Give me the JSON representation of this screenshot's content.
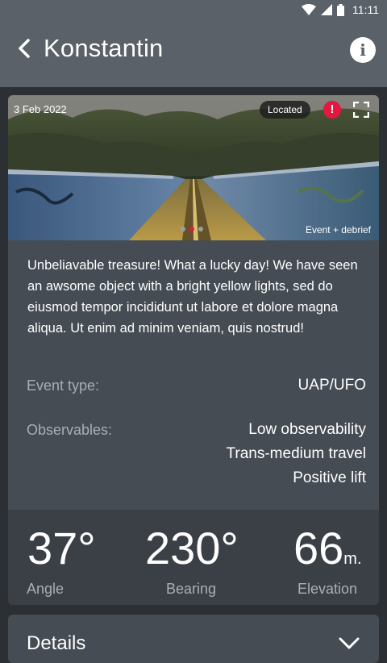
{
  "status_bar": {
    "time": "11:11",
    "icons": [
      "wifi-icon",
      "signal-icon",
      "battery-icon"
    ]
  },
  "app_bar": {
    "title": "Konstantin",
    "back_icon": "chevron-left-icon",
    "info_icon": "info-icon"
  },
  "card": {
    "date": "3 Feb 2022",
    "badge": "Located",
    "alert_glyph": "!",
    "caption": "Event + debrief",
    "carousel": {
      "count": 3,
      "active_index": 1
    },
    "description": "Unbeliavable treasure! What a lucky day! We have seen an awsome object with a bright yellow lights, sed do eiusmod tempor incididunt ut labore et dolore magna aliqua. Ut enim ad minim veniam, quis nostrud!",
    "event_type": {
      "label": "Event type:",
      "value": "UAP/UFO"
    },
    "observables": {
      "label": "Observables:",
      "values": [
        "Low observability",
        "Trans-medium travel",
        "Positive lift"
      ]
    },
    "stats": [
      {
        "value": "37°",
        "unit": "",
        "label": "Angle"
      },
      {
        "value": "230°",
        "unit": "",
        "label": "Bearing"
      },
      {
        "value": "66",
        "unit": "m.",
        "label": "Elevation"
      }
    ]
  },
  "details": {
    "title": "Details",
    "icon": "chevron-down-icon"
  },
  "colors": {
    "accent": "#e3173f",
    "app_bar": "#5a6168",
    "card": "#454c53",
    "background": "#2c3035"
  }
}
